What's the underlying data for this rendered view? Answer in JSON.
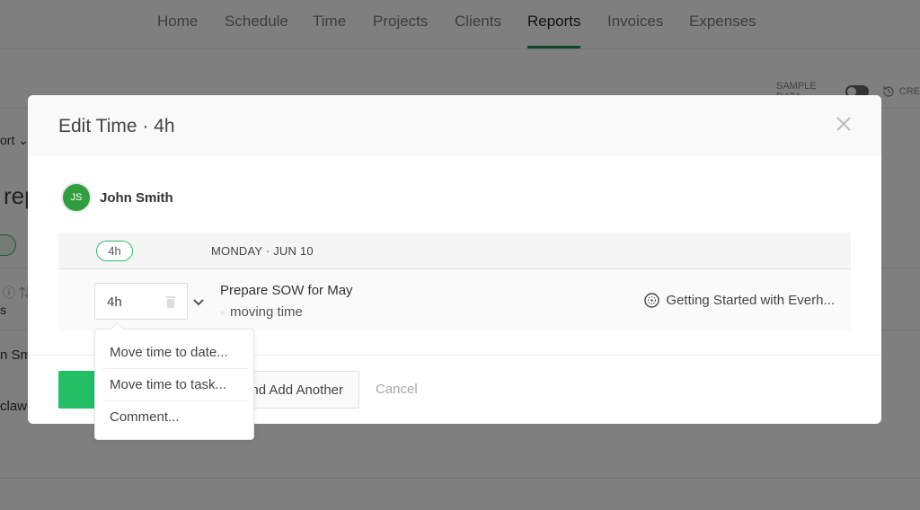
{
  "nav": {
    "tabs": [
      {
        "label": "Home",
        "active": false
      },
      {
        "label": "Schedule",
        "active": false
      },
      {
        "label": "Time",
        "active": false
      },
      {
        "label": "Projects",
        "active": false
      },
      {
        "label": "Clients",
        "active": false
      },
      {
        "label": "Reports",
        "active": true
      },
      {
        "label": "Invoices",
        "active": false
      },
      {
        "label": "Expenses",
        "active": false
      }
    ],
    "accent_color": "#1e8f4e"
  },
  "toolbar": {
    "sample_data_label": "SAMPLE DATA",
    "sample_data_on": false,
    "recent_label": "CRE"
  },
  "background": {
    "export_label": "ort",
    "heading_fragment": "rep",
    "col_fragment": "s",
    "row1_fragment": "n Sm",
    "row2_fragment": "claw+"
  },
  "modal": {
    "title": "Edit Time · 4h",
    "user": {
      "initials": "JS",
      "name": "John Smith",
      "avatar_color": "#2e9e3e"
    },
    "day": {
      "total": "4h",
      "label": "MONDAY · JUN 10"
    },
    "entry": {
      "time_value": "4h",
      "task_title": "Prepare SOW for May",
      "task_subtitle": "moving time",
      "project": "Getting Started with Everh..."
    },
    "buttons": {
      "save_label": "",
      "save_add_label": "Save and Add Another",
      "cancel_label": "Cancel",
      "primary_color": "#22bf65"
    },
    "menu": [
      {
        "label": "Move time to date..."
      },
      {
        "label": "Move time to task..."
      },
      {
        "label": "Comment..."
      }
    ]
  }
}
